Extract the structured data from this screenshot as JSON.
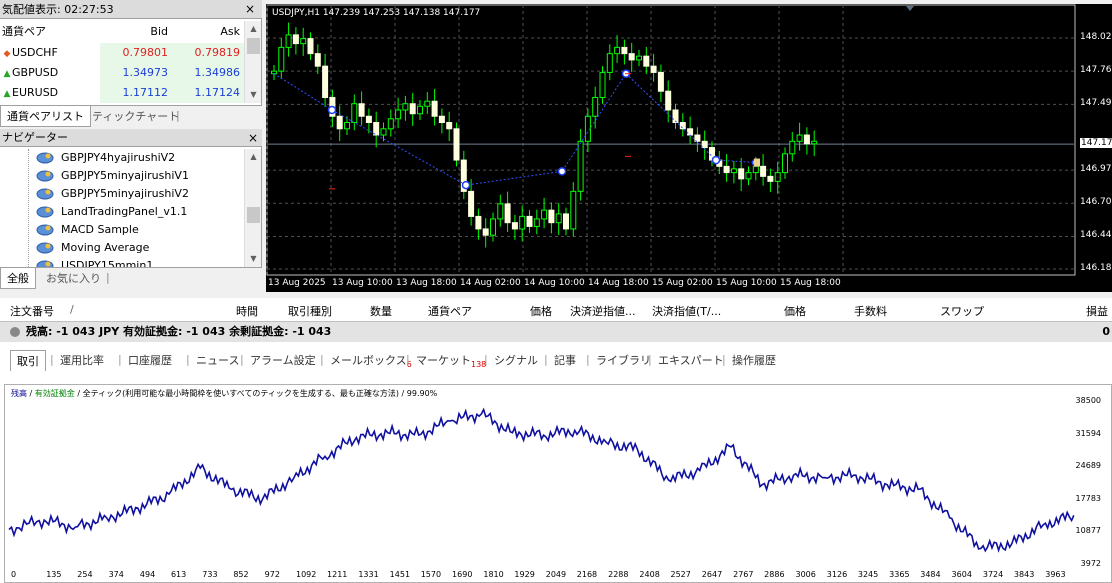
{
  "market_watch": {
    "title": "気配値表示: 02:27:53",
    "col_symbol": "通貨ペア",
    "col_bid": "Bid",
    "col_ask": "Ask",
    "rows": [
      {
        "symbol": "USDCHF",
        "bid": "0.79801",
        "ask": "0.79819",
        "dir": "down",
        "color": "#e02020"
      },
      {
        "symbol": "GBPUSD",
        "bid": "1.34973",
        "ask": "1.34986",
        "dir": "up",
        "color": "#1a3fd8"
      },
      {
        "symbol": "EURUSD",
        "bid": "1.17112",
        "ask": "1.17124",
        "dir": "up",
        "color": "#1a3fd8"
      }
    ],
    "tabs": [
      "通貨ペアリスト",
      "ティックチャート"
    ]
  },
  "navigator": {
    "title": "ナビゲーター",
    "items": [
      "GBPJPY4hyajirushiV2",
      "GBPJPY5minyajirushiV1",
      "GBPJPY5minyajirushiV2",
      "LandTradingPanel_v1.1",
      "MACD Sample",
      "Moving Average",
      "USDJPY15mmin1"
    ],
    "tabs": [
      "全般",
      "お気に入り"
    ]
  },
  "chart": {
    "info": "USDJPY,H1  147.239 147.253 147.138 147.177",
    "price_labels": [
      "148.025",
      "147.760",
      "147.495",
      "147.177",
      "146.970",
      "146.705",
      "146.440",
      "146.180"
    ],
    "current_price": "147.177",
    "time_labels": [
      "13 Aug 2025",
      "13 Aug 10:00",
      "13 Aug 18:00",
      "14 Aug 02:00",
      "14 Aug 10:00",
      "14 Aug 18:00",
      "15 Aug 02:00",
      "15 Aug 10:00",
      "15 Aug 18:00"
    ]
  },
  "terminal": {
    "headers": [
      "注文番号",
      "/",
      "時間",
      "取引種別",
      "数量",
      "通貨ペア",
      "価格",
      "決済逆指値...",
      "決済指値(T/...",
      "価格",
      "手数料",
      "スワップ",
      "損益"
    ],
    "balance": "残高: -1 043 JPY  有効証拠金: -1 043  余剰証拠金: -1 043",
    "balance_right": "0",
    "tabs": [
      {
        "label": "取引",
        "badge": ""
      },
      {
        "label": "運用比率",
        "badge": ""
      },
      {
        "label": "口座履歴",
        "badge": ""
      },
      {
        "label": "ニュース",
        "badge": ""
      },
      {
        "label": "アラーム設定",
        "badge": ""
      },
      {
        "label": "メールボックス",
        "badge": "6"
      },
      {
        "label": "マーケット",
        "badge": "138"
      },
      {
        "label": "シグナル",
        "badge": ""
      },
      {
        "label": "記事",
        "badge": ""
      },
      {
        "label": "ライブラリ",
        "badge": ""
      },
      {
        "label": "エキスパート",
        "badge": ""
      },
      {
        "label": "操作履歴",
        "badge": ""
      }
    ]
  },
  "graph": {
    "legend_balance": "残高",
    "legend_equity": "有効証拠金",
    "legend_rest": "/ 全ティック(利用可能な最小時間枠を使いすべてのティックを生成する、最も正確な方法) / 99.90%",
    "x_labels": [
      "0",
      "135",
      "254",
      "374",
      "494",
      "613",
      "733",
      "852",
      "972",
      "1092",
      "1211",
      "1331",
      "1451",
      "1570",
      "1690",
      "1810",
      "1929",
      "2049",
      "2168",
      "2288",
      "2408",
      "2527",
      "2647",
      "2767",
      "2886",
      "3006",
      "3126",
      "3245",
      "3365",
      "3484",
      "3604",
      "3724",
      "3843",
      "3963"
    ],
    "y_labels": [
      "38500",
      "31594",
      "24689",
      "17783",
      "10877",
      "3972"
    ]
  },
  "chart_data": {
    "type": "line",
    "title": "",
    "xlabel": "",
    "ylabel": "",
    "xlim": [
      0,
      4100
    ],
    "ylim": [
      3972,
      40000
    ],
    "series": [
      {
        "name": "残高",
        "x": [
          0,
          135,
          254,
          374,
          494,
          613,
          733,
          852,
          972,
          1092,
          1211,
          1331,
          1451,
          1570,
          1690,
          1810,
          1929,
          2049,
          2168,
          2288,
          2408,
          2527,
          2647,
          2767,
          2886,
          3006,
          3126,
          3245,
          3365,
          3484,
          3604,
          3724,
          3843,
          3963,
          4080
        ],
        "y": [
          11500,
          13500,
          12000,
          14000,
          16000,
          19000,
          24500,
          20000,
          18000,
          22500,
          27000,
          31000,
          32000,
          31500,
          34500,
          36000,
          32000,
          31500,
          32500,
          30000,
          28500,
          22000,
          24000,
          29000,
          21000,
          23000,
          22500,
          23000,
          21000,
          20000,
          14000,
          7500,
          8500,
          12500,
          14500
        ]
      }
    ]
  }
}
